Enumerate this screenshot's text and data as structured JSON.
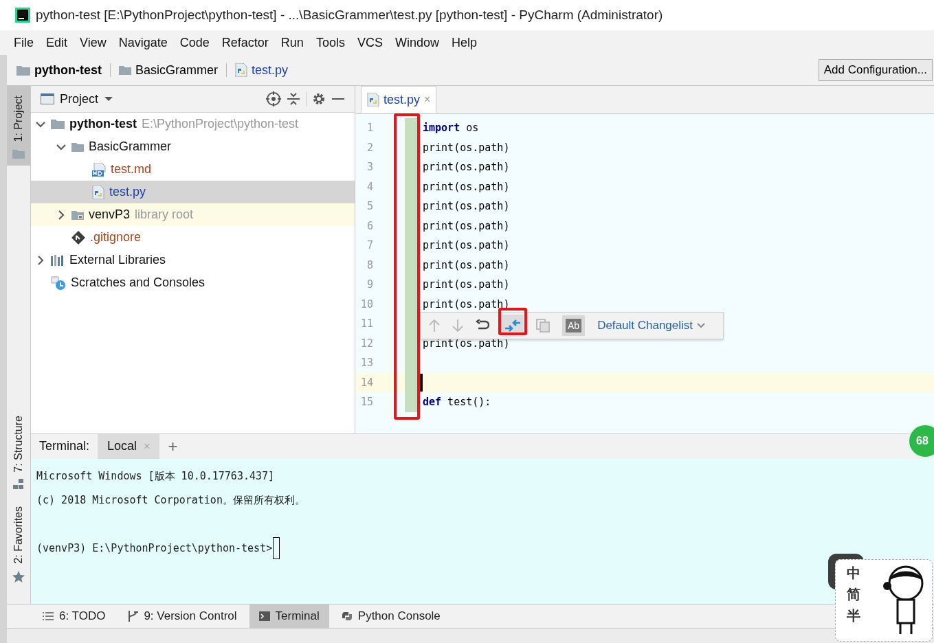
{
  "window": {
    "title": "python-test [E:\\PythonProject\\python-test] - ...\\BasicGrammer\\test.py [python-test] - PyCharm (Administrator)"
  },
  "menu": [
    "File",
    "Edit",
    "View",
    "Navigate",
    "Code",
    "Refactor",
    "Run",
    "Tools",
    "VCS",
    "Window",
    "Help"
  ],
  "breadcrumbs": [
    {
      "label": "python-test",
      "kind": "project"
    },
    {
      "label": "BasicGrammer",
      "kind": "folder"
    },
    {
      "label": "test.py",
      "kind": "py"
    }
  ],
  "add_configuration": "Add Configuration...",
  "tool_strip": [
    {
      "label": "1: Project",
      "kind": "folder",
      "selected": true
    },
    {
      "label": "7: Structure",
      "kind": "structure",
      "selected": false
    },
    {
      "label": "2: Favorites",
      "kind": "star",
      "selected": false
    }
  ],
  "project_panel": {
    "title": "Project",
    "tree": [
      {
        "label": "python-test",
        "kind": "project",
        "hint": "E:\\PythonProject\\python-test",
        "expanded": true,
        "selected": false,
        "children": [
          {
            "label": "BasicGrammer",
            "kind": "folder",
            "expanded": true,
            "selected": false,
            "children": [
              {
                "label": "test.md",
                "kind": "md",
                "color": "#a6461c",
                "selected": false
              },
              {
                "label": "test.py",
                "kind": "py",
                "color": "#1c3fb0",
                "selected": true
              }
            ]
          },
          {
            "label": "venvP3",
            "kind": "venv",
            "hint": "library root",
            "expanded": false,
            "selected": false
          },
          {
            "label": ".gitignore",
            "kind": "git",
            "color": "#a6461c",
            "selected": false
          }
        ]
      },
      {
        "label": "External Libraries",
        "kind": "libraries",
        "expanded": false,
        "selected": false
      },
      {
        "label": "Scratches and Consoles",
        "kind": "scratches",
        "selected": false
      }
    ]
  },
  "editor": {
    "tabs": [
      {
        "label": "test.py",
        "close": "×",
        "selected": true
      }
    ],
    "lines": [
      {
        "number": "1",
        "code": "**import** os",
        "current": false
      },
      {
        "number": "2",
        "code": "print(os.path)",
        "current": false
      },
      {
        "number": "3",
        "code": "print(os.path)",
        "current": false
      },
      {
        "number": "4",
        "code": "print(os.path)",
        "current": false
      },
      {
        "number": "5",
        "code": "print(os.path)",
        "current": false
      },
      {
        "number": "6",
        "code": "print(os.path)",
        "current": false
      },
      {
        "number": "7",
        "code": "print(os.path)",
        "current": false
      },
      {
        "number": "8",
        "code": "print(os.path)",
        "current": false
      },
      {
        "number": "9",
        "code": "print(os.path)",
        "current": false
      },
      {
        "number": "10",
        "code": "print(os.path)",
        "current": false
      },
      {
        "number": "11",
        "current": false
      },
      {
        "number": "12",
        "code": "print(os.path)",
        "current": false
      },
      {
        "number": "13",
        "current": false
      },
      {
        "number": "14",
        "current": true
      },
      {
        "number": "15",
        "code": "**def** test():",
        "current": false
      }
    ],
    "change_popup": {
      "ab_label": "Ab",
      "changelist": "Default Changelist"
    }
  },
  "badge": "68",
  "terminal": {
    "title": "Terminal:",
    "tabs": [
      {
        "label": "Local",
        "close": "×",
        "selected": true
      }
    ],
    "add": "+",
    "lines": [
      {
        "kind": "output",
        "text": "Microsoft Windows [版本 10.0.17763.437]"
      },
      {
        "kind": "output",
        "text": "(c) 2018 Microsoft Corporation。保留所有权利。"
      },
      {
        "kind": "prompt",
        "text": "(venvP3) E:\\PythonProject\\python-test>"
      }
    ]
  },
  "bottom_tools": [
    {
      "label": "6: TODO",
      "kind": "list",
      "selected": false
    },
    {
      "label": "9: Version Control",
      "kind": "vcs",
      "selected": false
    },
    {
      "label": "Terminal",
      "kind": "terminal",
      "selected": true
    },
    {
      "label": "Python Console",
      "kind": "python",
      "selected": false
    }
  ],
  "ime": {
    "modes": [
      "中",
      "简",
      "半"
    ]
  }
}
